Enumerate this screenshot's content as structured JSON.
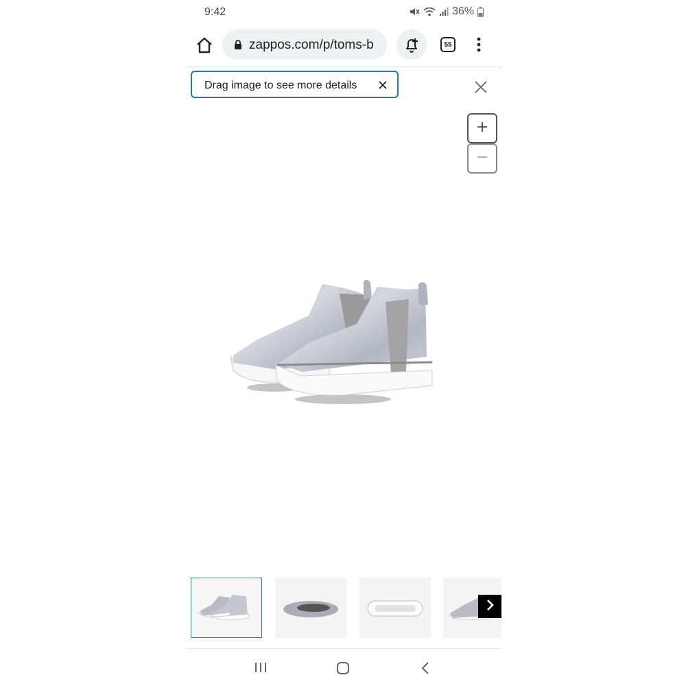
{
  "status_bar": {
    "time": "9:42",
    "battery": "36%",
    "icons": [
      "mute-icon",
      "wifi-icon",
      "signal-icon",
      "battery-icon"
    ]
  },
  "browser": {
    "url": "zappos.com/p/toms-b",
    "tab_count": "55",
    "icons": [
      "home-icon",
      "lock-icon",
      "bell-plus-icon",
      "tabs-icon",
      "more-vert-icon"
    ]
  },
  "viewer": {
    "tooltip": "Drag image to see more details",
    "zoom_in": "+",
    "zoom_out": "−"
  },
  "thumbnails": {
    "count": 4,
    "selected_index": 0,
    "next_icon": "chevron-right-icon"
  },
  "android_nav": {
    "icons": [
      "recents-icon",
      "home-circle-icon",
      "back-icon"
    ]
  },
  "colors": {
    "accent": "#1a7bbf",
    "shoe_gray": "#b9bcc6",
    "elastic_gray": "#9a9a9a"
  }
}
